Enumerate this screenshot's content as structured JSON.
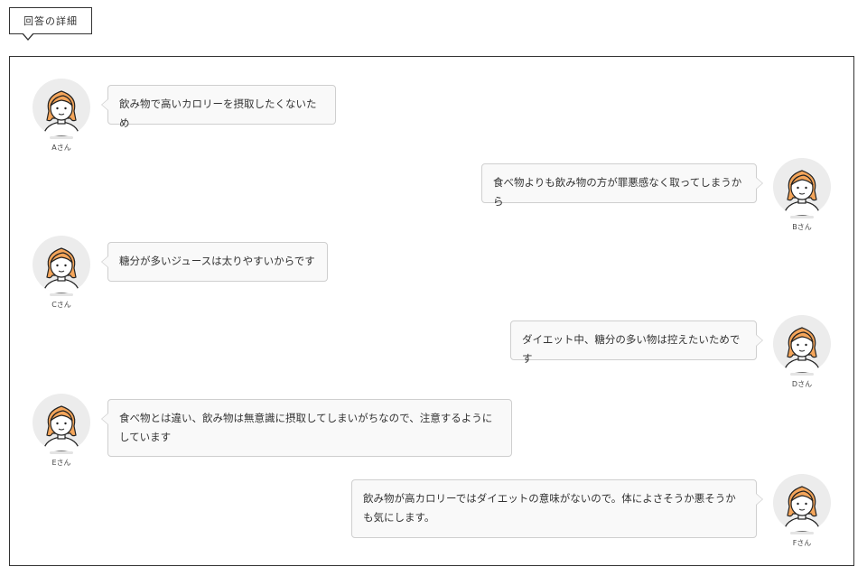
{
  "header": {
    "tab_label": "回答の詳細"
  },
  "colors": {
    "bubble_bg": "#f9f9f9",
    "bubble_border": "#cfcfcf",
    "hair": "#f4a55a",
    "avatar_bg": "#ececec"
  },
  "messages": [
    {
      "name": "Aさん",
      "side": "left",
      "text": "飲み物で高いカロリーを摂取したくないため",
      "icon": "girl-avatar-icon"
    },
    {
      "name": "Bさん",
      "side": "right",
      "text": "食べ物よりも飲み物の方が罪悪感なく取ってしまうから",
      "icon": "girl-avatar-icon"
    },
    {
      "name": "Cさん",
      "side": "left",
      "text": "糖分が多いジュースは太りやすいからです",
      "icon": "girl-avatar-icon"
    },
    {
      "name": "Dさん",
      "side": "right",
      "text": "ダイエット中、糖分の多い物は控えたいためです",
      "icon": "girl-avatar-icon"
    },
    {
      "name": "Eさん",
      "side": "left",
      "text": "食べ物とは違い、飲み物は無意識に摂取してしまいがちなので、注意するようにしています",
      "icon": "girl-avatar-icon"
    },
    {
      "name": "Fさん",
      "side": "right",
      "text": "飲み物が高カロリーではダイエットの意味がないので。体によさそうか悪そうかも気にします。",
      "icon": "girl-avatar-icon"
    }
  ]
}
